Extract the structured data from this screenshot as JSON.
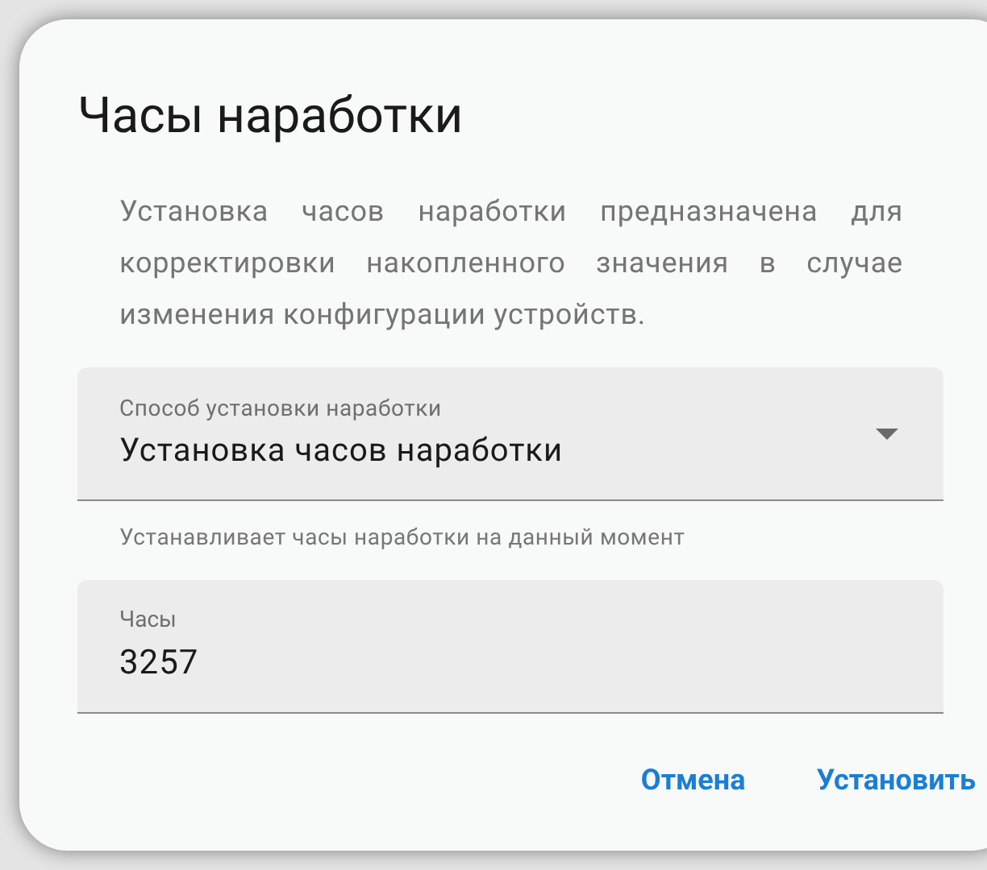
{
  "dialog": {
    "title": "Часы наработки",
    "description": "Установка часов наработки предназначена для корректировки накопленного значения в случае изменения конфигурации устройств.",
    "select": {
      "label": "Способ установки наработки",
      "value": "Установка часов наработки",
      "helper": "Устанавливает часы наработки на данный момент"
    },
    "hours": {
      "label": "Часы",
      "value": "3257"
    },
    "buttons": [
      "Отмена",
      "Установить"
    ]
  }
}
